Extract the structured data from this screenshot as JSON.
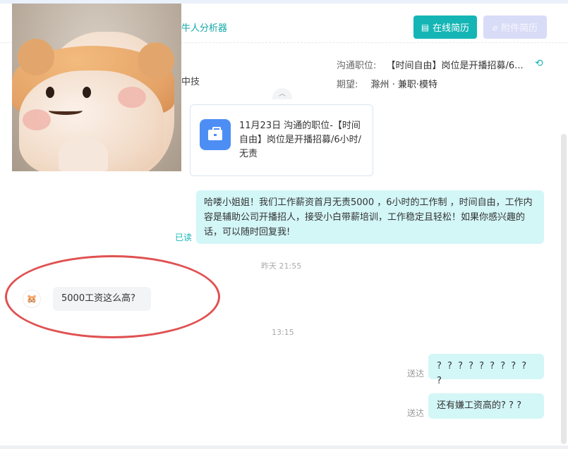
{
  "header": {
    "analyzer_link": "牛人分析器",
    "online_resume": "在线简历",
    "attachment_resume": "附件简历",
    "company_partial": "中技",
    "job_label": "沟通职位:",
    "job_value": "【时间自由】岗位是开播招募/6...",
    "expect_label": "期望:",
    "expect_value": "滁州 · 兼职·模特"
  },
  "chat": {
    "job_card": "11月23日 沟通的职位-【时间自由】岗位是开播招募/6小时/无责",
    "messages": [
      {
        "from": "me",
        "text": "哈喽小姐姐！我们工作薪资首月无责5000 ，6小时的工作制 ，时间自由，工作内容是辅助公司开播招人，接受小白带薪培训，工作稳定且轻松！如果你感兴趣的话，可以随时回复我!",
        "status": "已读"
      },
      {
        "time": "昨天 21:55"
      },
      {
        "from": "them",
        "text": "5000工资这么高?"
      },
      {
        "time": "13:15"
      },
      {
        "from": "me",
        "text": "? ? ? ? ? ? ? ? ? ?",
        "status": "送达"
      },
      {
        "from": "me",
        "text": "还有嫌工资高的? ? ?",
        "status": "送达"
      }
    ]
  },
  "colors": {
    "accent": "#15b5b5",
    "annotation_circle": "#e05151"
  }
}
